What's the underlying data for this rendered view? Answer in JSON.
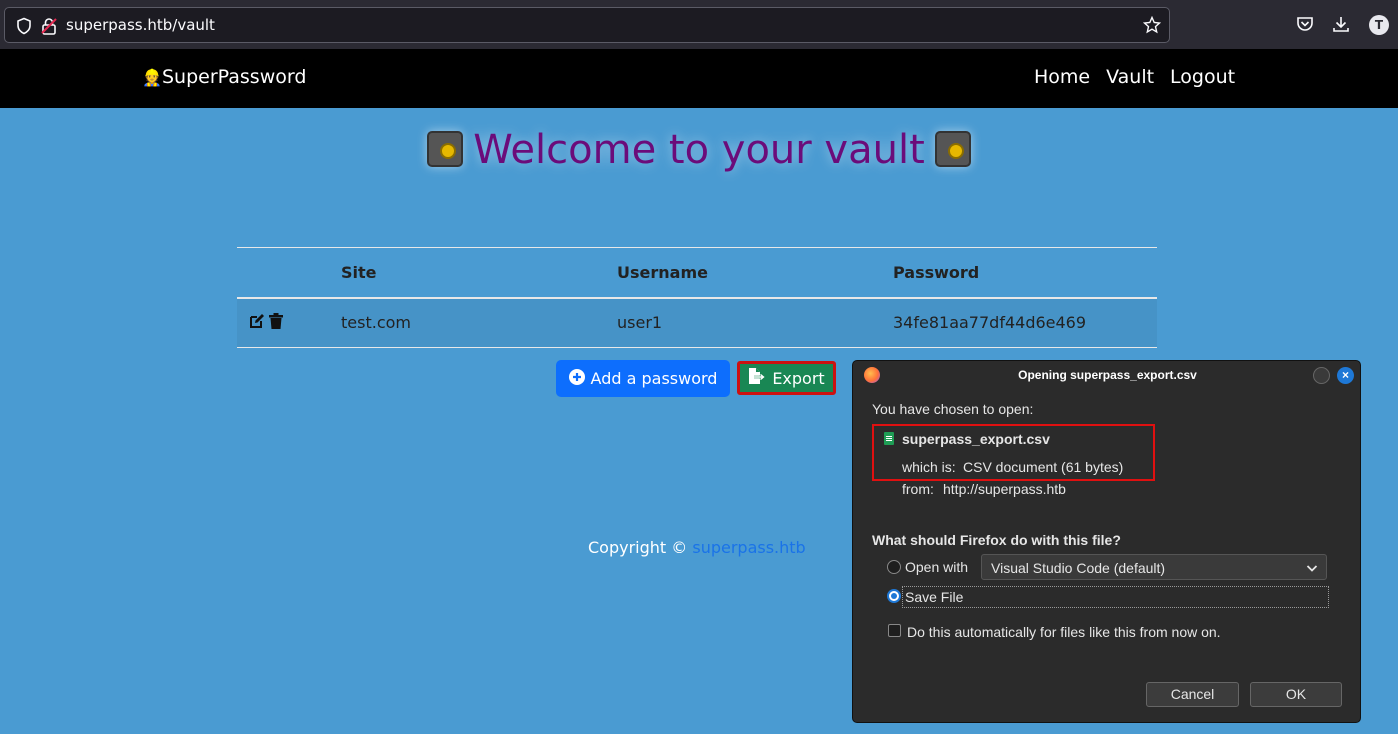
{
  "browser": {
    "url": "superpass.htb/vault",
    "avatar_letter": "T"
  },
  "navbar": {
    "brand": "SuperPassword",
    "brand_icon": "👷",
    "links": [
      "Home",
      "Vault",
      "Logout"
    ]
  },
  "heading": "Welcome to your vault",
  "table": {
    "headers": [
      "Site",
      "Username",
      "Password"
    ],
    "rows": [
      {
        "site": "test.com",
        "username": "user1",
        "password": "34fe81aa77df44d6e469"
      }
    ]
  },
  "buttons": {
    "add": "Add a password",
    "export": "Export"
  },
  "footer": {
    "text": "Copyright ©",
    "link": "superpass.htb"
  },
  "dialog": {
    "title": "Opening superpass_export.csv",
    "intro": "You have chosen to open:",
    "filename": "superpass_export.csv",
    "which_is_label": "which is:",
    "which_is_value": "CSV document (61 bytes)",
    "from_label": "from:",
    "from_value": "http://superpass.htb",
    "question": "What should Firefox do with this file?",
    "open_with_label": "Open with",
    "open_with_app": "Visual Studio Code (default)",
    "save_file_label": "Save File",
    "auto_label": "Do this automatically for files like this from now on.",
    "cancel": "Cancel",
    "ok": "OK"
  },
  "colors": {
    "page_bg": "#4a9bd2",
    "heading": "#6b0c7a",
    "primary": "#0d6efd",
    "success": "#198754",
    "highlight_border": "#e01010"
  }
}
